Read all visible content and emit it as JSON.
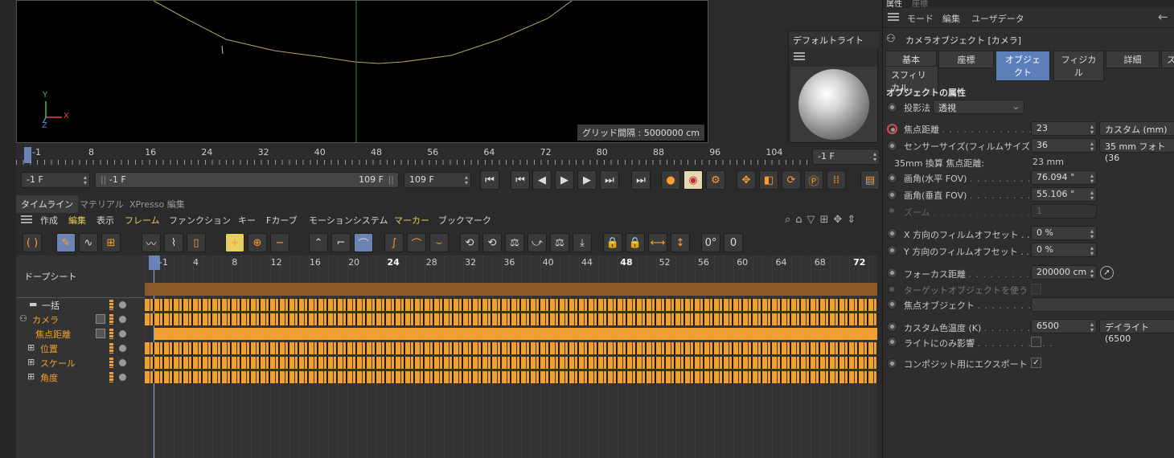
{
  "viewport": {
    "grid_label": "グリッド間隔 : 5000000 cm",
    "axis_x": "X",
    "axis_y": "Y",
    "axis_z": "Z"
  },
  "light_panel": {
    "title": "デフォルトライト"
  },
  "ruler": {
    "ticks": [
      "-1",
      "8",
      "16",
      "24",
      "32",
      "40",
      "48",
      "56",
      "64",
      "72",
      "80",
      "88",
      "96",
      "104"
    ],
    "current_frame": "-1 F"
  },
  "playback": {
    "start": "-1 F",
    "range_start": "-1 F",
    "range_end": "109 F",
    "end": "109 F"
  },
  "tabs": [
    "タイムライン",
    "マテリアル",
    "XPresso 編集"
  ],
  "timeline_menu": [
    "作成",
    "編集",
    "表示",
    "フレーム",
    "ファンクション",
    "キー",
    "Fカーブ",
    "モーションシステム",
    "マーカー",
    "ブックマーク"
  ],
  "dopesheet": {
    "header": "ドープシート",
    "ticks": [
      "-1",
      "4",
      "8",
      "12",
      "16",
      "20",
      "24",
      "28",
      "32",
      "36",
      "40",
      "44",
      "48",
      "52",
      "56",
      "60",
      "64",
      "68",
      "72"
    ],
    "bold_ticks": [
      "24",
      "48",
      "72"
    ],
    "rows": [
      {
        "label": "一括",
        "color": "#e0e0e0"
      },
      {
        "label": "カメラ",
        "color": "#f0a030"
      },
      {
        "label": "焦点距離",
        "color": "#f0a030"
      },
      {
        "label": "位置",
        "color": "#f0a030"
      },
      {
        "label": "スケール",
        "color": "#f0a030"
      },
      {
        "label": "角度",
        "color": "#f0a030"
      }
    ]
  },
  "attributes": {
    "panel_tabs": [
      "属性",
      "座標"
    ],
    "menu": [
      "モード",
      "編集",
      "ユーザデータ"
    ],
    "object_title": "カメラオブジェクト [カメラ]",
    "sub_tabs": [
      "基本",
      "座標",
      "オブジェクト",
      "フィジカル",
      "詳細",
      "ス"
    ],
    "sub_tab2": "スフィリカル",
    "section": "オブジェクトの属性",
    "projection_label": "投影法",
    "projection_value": "透視",
    "focal_label": "焦点距離",
    "focal_value": "23",
    "focal_preset": "カスタム (mm)",
    "sensor_label": "センサーサイズ(フィルムサイズ)",
    "sensor_value": "36",
    "sensor_preset": "35 mm フォト (36",
    "equiv_label": "35mm 換算 焦点距離:",
    "equiv_value": "23 mm",
    "hfov_label": "画角(水平 FOV)",
    "hfov_value": "76.094 °",
    "vfov_label": "画角(垂直 FOV)",
    "vfov_value": "55.106 °",
    "zoom_label": "ズーム",
    "zoom_value": "1",
    "xoff_label": "X 方向のフィルムオフセット . .",
    "xoff_value": "0 %",
    "yoff_label": "Y 方向のフィルムオフセット . .",
    "yoff_value": "0 %",
    "focus_label": "フォーカス距離",
    "focus_value": "200000 cm",
    "target_label": "ターゲットオブジェクトを使う",
    "focusobj_label": "焦点オブジェクト",
    "temp_label": "カスタム色温度 (K)",
    "temp_value": "6500",
    "temp_preset": "デイライト (6500",
    "lightonly_label": "ライトにのみ影響",
    "composite_label": "コンポジット用にエクスポート"
  }
}
